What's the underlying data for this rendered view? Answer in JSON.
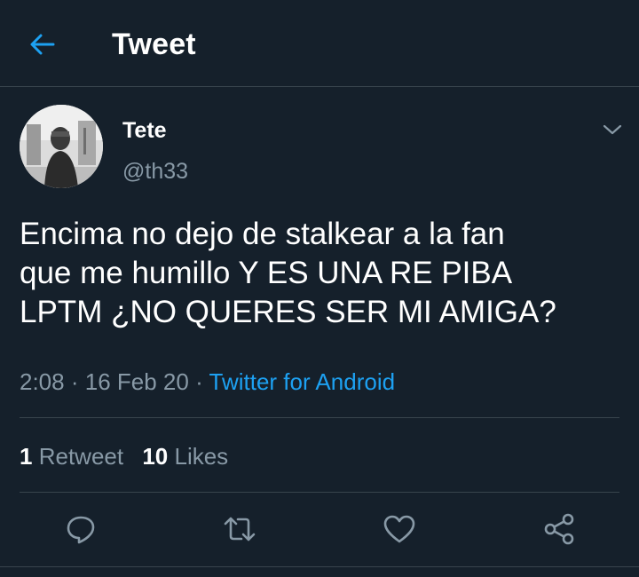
{
  "header": {
    "title": "Tweet",
    "back_icon": "arrow-left-icon"
  },
  "tweet": {
    "author": {
      "display_name": "Tete",
      "handle": "@th33",
      "avatar": "avatar-photo"
    },
    "text": "Encima no dejo de stalkear a la fan\nque me humillo Y ES UNA RE PIBA\nLPTM ¿NO QUERES SER MI AMIGA?",
    "time": "2:08",
    "date": "16 Feb 20",
    "separator": "·",
    "source": "Twitter for Android",
    "stats": {
      "retweets_count": "1",
      "retweets_label": "Retweet",
      "likes_count": "10",
      "likes_label": "Likes"
    },
    "actions": [
      "reply-icon",
      "retweet-icon",
      "like-icon",
      "share-icon"
    ]
  },
  "colors": {
    "background": "#15202b",
    "divider": "#38444d",
    "secondary_text": "#8899a6",
    "accent": "#1da1f2",
    "primary_text": "#ffffff"
  }
}
